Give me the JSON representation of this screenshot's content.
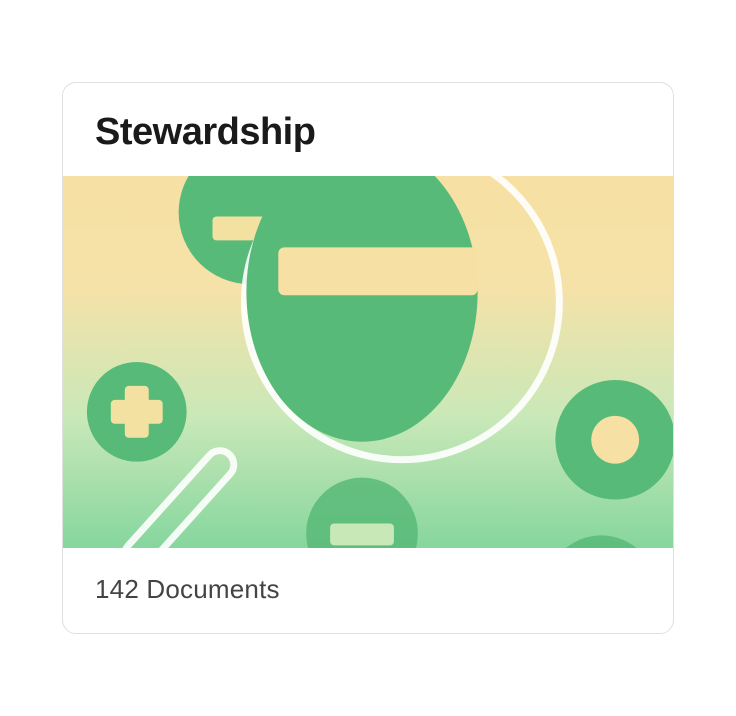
{
  "card": {
    "title": "Stewardship",
    "document_count_label": "142 Documents"
  }
}
